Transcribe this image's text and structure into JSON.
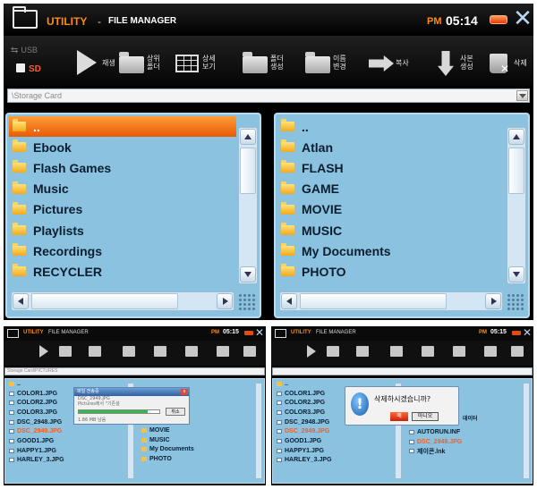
{
  "titlebar": {
    "app": "UTILITY",
    "separator": "-",
    "name": "FILE MANAGER",
    "ampm": "PM",
    "time": "05:14",
    "close_glyph": "✕"
  },
  "storage": {
    "usb_label": "USB",
    "sd_label": "SD"
  },
  "toolbar": [
    {
      "label": "재생",
      "icon": "play-icon"
    },
    {
      "label": "상위\n폴더",
      "icon": "up-folder-icon"
    },
    {
      "label": "상세\n보기",
      "icon": "detail-view-icon"
    },
    {
      "label": "폴더\n생성",
      "icon": "new-folder-icon"
    },
    {
      "label": "이름\n변경",
      "icon": "rename-icon"
    },
    {
      "label": "복사",
      "icon": "copy-icon"
    },
    {
      "label": "사본\n생성",
      "icon": "duplicate-icon"
    },
    {
      "label": "삭제",
      "icon": "delete-icon"
    }
  ],
  "path": {
    "value": "\\Storage Card"
  },
  "left_pane": {
    "items": [
      "..",
      "Ebook",
      "Flash Games",
      "Music",
      "Pictures",
      "Playlists",
      "Recordings",
      "RECYCLER"
    ],
    "selected_index": 0
  },
  "right_pane": {
    "items": [
      "..",
      "Atlan",
      "FLASH",
      "GAME",
      "MOVIE",
      "MUSIC",
      "My Documents",
      "PHOTO"
    ]
  },
  "copy_screen": {
    "time": "05:15",
    "path": "Storage Card\\PICTURES",
    "files": [
      "..",
      "COLOR1.JPG",
      "COLOR2.JPG",
      "COLOR3.JPG",
      "DSC_2948.JPG",
      "DSC_2949.JPG",
      "GOOD1.JPG",
      "HAPPY1.JPG",
      "HARLEY_3.JPG"
    ],
    "highlight_index": 5,
    "right_items": [
      "MOVIE",
      "MUSIC",
      "My Documents",
      "PHOTO"
    ],
    "dialog": {
      "title": "파일 전송중",
      "file": "DSC_2949.JPG",
      "dest": "Pictures에서 \"기존설",
      "size": "1.86 MB 남음",
      "progress": 0.85,
      "button": "취소"
    }
  },
  "delete_screen": {
    "time": "05:15",
    "files": [
      "..",
      "COLOR1.JPG",
      "COLOR2.JPG",
      "COLOR3.JPG",
      "DSC_2948.JPG",
      "DSC_2949.JPG",
      "GOOD1.JPG",
      "HAPPY1.JPG",
      "HARLEY_3.JPG"
    ],
    "highlight_index": 5,
    "right_items": [
      "AUTORUN.INF",
      "DSC_2949.JPG",
      "제이콘.lnk"
    ],
    "right_side_text": "데이터",
    "dialog": {
      "message": "삭제하시겠습니까?",
      "yes": "예",
      "no": "아니오"
    }
  },
  "colors": {
    "accent": "#ff8c10",
    "pane": "#8bc2e0",
    "selection": "#e85b05"
  }
}
